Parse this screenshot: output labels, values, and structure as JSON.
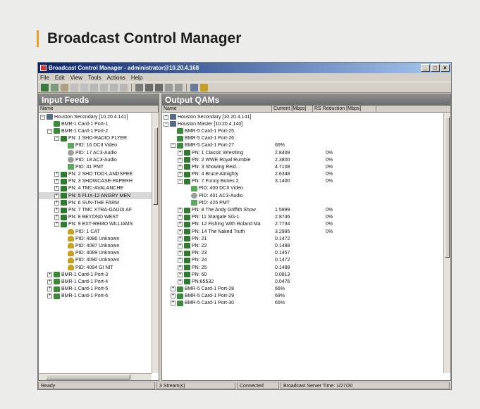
{
  "heading": "Broadcast Control Manager",
  "window": {
    "title": "Broadcast Control Manager - administrator@10.20.4.168",
    "minimize": "_",
    "restore": "□",
    "close": "×"
  },
  "menu": [
    "File",
    "Edit",
    "View",
    "Tools",
    "Actions",
    "Help"
  ],
  "input_feeds": {
    "title": "Input Feeds",
    "col_name": "Name",
    "rows": [
      {
        "exp": "−",
        "icon": "host",
        "text": "Houston Secondary [10.20.4.141]"
      },
      {
        "exp": "",
        "icon": "card",
        "text": "BMR-1 Card-1 Port-1"
      },
      {
        "exp": "−",
        "icon": "card",
        "text": "BMR-1 Card-1 Port-2"
      },
      {
        "exp": "−",
        "icon": "pn",
        "text": "PN:   1 SHO-RADIO FLYER"
      },
      {
        "exp": "",
        "icon": "pid",
        "text": "PID:   16 DCII Video"
      },
      {
        "exp": "",
        "icon": "audio",
        "text": "PID:   17 AC3-Audio"
      },
      {
        "exp": "",
        "icon": "audio",
        "text": "PID:   18 AC3-Audio"
      },
      {
        "exp": "",
        "icon": "pid",
        "text": "PID:   41 PMT"
      },
      {
        "exp": "+",
        "icon": "pn",
        "text": "PN:   2 SHO TOO-LANDSPEE"
      },
      {
        "exp": "+",
        "icon": "pn",
        "text": "PN:   3 SHOWCASE-PAPERH"
      },
      {
        "exp": "+",
        "icon": "pn",
        "text": "PN:   4 TMC-AVALANCHE"
      },
      {
        "exp": "+",
        "icon": "pn",
        "text": "PN:   5 FLIX-12 ANGRY MEN"
      },
      {
        "exp": "+",
        "icon": "pn",
        "text": "PN:   6 SUN-THE FARM"
      },
      {
        "exp": "+",
        "icon": "pn",
        "text": "PN:   7 TMC XTRA-GAUDI AF"
      },
      {
        "exp": "+",
        "icon": "pn",
        "text": "PN:   8 BEYOND WEST"
      },
      {
        "exp": "+",
        "icon": "pn",
        "text": "PN:   9 EXT-REMO WILLIAMS"
      },
      {
        "exp": "",
        "icon": "unk",
        "text": "PID:   1 CAT"
      },
      {
        "exp": "",
        "icon": "unk",
        "text": "PID: 4086 Unknown"
      },
      {
        "exp": "",
        "icon": "unk",
        "text": "PID: 4087 Unknown"
      },
      {
        "exp": "",
        "icon": "unk",
        "text": "PID: 4089 Unknown"
      },
      {
        "exp": "",
        "icon": "unk",
        "text": "PID: 4090 Unknown"
      },
      {
        "exp": "",
        "icon": "unk",
        "text": "PID: 4094 GI NIT"
      },
      {
        "exp": "+",
        "icon": "card",
        "text": "BMR-1 Card-1 Port-3"
      },
      {
        "exp": "+",
        "icon": "card",
        "text": "BMR-1 Card-1 Port-4"
      },
      {
        "exp": "+",
        "icon": "card",
        "text": "BMR-1 Card-1 Port-5"
      },
      {
        "exp": "+",
        "icon": "card",
        "text": "BMR-1 Card-1 Port-6"
      }
    ]
  },
  "output_qams": {
    "title": "Output QAMs",
    "col_name": "Name",
    "col_rate": "Current [Mbps]",
    "col_rs": "RS Reduction [Mbps]",
    "rows": [
      {
        "exp": "+",
        "icon": "host",
        "text": "Houston Secondary [10.20.4.141]",
        "rate": "",
        "rs": ""
      },
      {
        "exp": "−",
        "icon": "host",
        "text": "Houston Master [10.20.4.140]",
        "rate": "",
        "rs": ""
      },
      {
        "exp": "",
        "icon": "card",
        "text": "BMR-5 Card-1 Port-25",
        "rate": "",
        "rs": ""
      },
      {
        "exp": "",
        "icon": "card",
        "text": "BMR-5 Card-1 Port-26",
        "rate": "",
        "rs": ""
      },
      {
        "exp": "−",
        "icon": "card",
        "text": "BMR-5 Card-1 Port-27",
        "rate": "66%",
        "rs": ""
      },
      {
        "exp": "+",
        "icon": "pn",
        "text": "PN:   1 Classic Wrestling",
        "rate": "2.8409",
        "rs": "0%"
      },
      {
        "exp": "+",
        "icon": "pn",
        "text": "PN:   2 WWE Royal Rumble",
        "rate": "2.3800",
        "rs": "0%"
      },
      {
        "exp": "+",
        "icon": "pn",
        "text": "PN:   3 Showing Reid...",
        "rate": "4.7108",
        "rs": "0%"
      },
      {
        "exp": "+",
        "icon": "pn",
        "text": "PN:   4 Bruce Almighty",
        "rate": "2.6348",
        "rs": "0%"
      },
      {
        "exp": "−",
        "icon": "pn",
        "text": "PN:   7 Funny Bones 2",
        "rate": "3.1400",
        "rs": "0%"
      },
      {
        "exp": "",
        "icon": "pid",
        "text": "PID:  400 DCII Video",
        "rate": "",
        "rs": ""
      },
      {
        "exp": "",
        "icon": "audio",
        "text": "PID:  401 AC3-Audio",
        "rate": "",
        "rs": ""
      },
      {
        "exp": "",
        "icon": "pid",
        "text": "PID:  425 PMT",
        "rate": "",
        "rs": ""
      },
      {
        "exp": "+",
        "icon": "pn",
        "text": "PN:   8 The Andy Griffith Show",
        "rate": "1.5999",
        "rs": "0%"
      },
      {
        "exp": "+",
        "icon": "pn",
        "text": "PN:  11 Stargate SG-1",
        "rate": "2.8746",
        "rs": "0%"
      },
      {
        "exp": "+",
        "icon": "pn",
        "text": "PN:  12 Fishing With Roland Ma",
        "rate": "2.7734",
        "rs": "0%"
      },
      {
        "exp": "+",
        "icon": "pn",
        "text": "PN:  14 The Naked Truth",
        "rate": "3.2995",
        "rs": "0%"
      },
      {
        "exp": "+",
        "icon": "pn",
        "text": "PN:  21",
        "rate": "0.1472",
        "rs": ""
      },
      {
        "exp": "+",
        "icon": "pn",
        "text": "PN:  22",
        "rate": "0.1488",
        "rs": ""
      },
      {
        "exp": "+",
        "icon": "pn",
        "text": "PN:  23",
        "rate": "0.1457",
        "rs": ""
      },
      {
        "exp": "+",
        "icon": "pn",
        "text": "PN:  24",
        "rate": "0.1472",
        "rs": ""
      },
      {
        "exp": "+",
        "icon": "pn",
        "text": "PN:  25",
        "rate": "0.1488",
        "rs": ""
      },
      {
        "exp": "+",
        "icon": "pn",
        "text": "PN:  60",
        "rate": "0.0813",
        "rs": ""
      },
      {
        "exp": "+",
        "icon": "pn",
        "text": "PN:65532",
        "rate": "0.0476",
        "rs": ""
      },
      {
        "exp": "+",
        "icon": "card",
        "text": "BMR-5 Card-1 Port-28",
        "rate": "66%",
        "rs": ""
      },
      {
        "exp": "+",
        "icon": "card",
        "text": "BMR-5 Card-1 Port-29",
        "rate": "69%",
        "rs": ""
      },
      {
        "exp": "+",
        "icon": "card",
        "text": "BMR-5 Card-1 Port-30",
        "rate": "65%",
        "rs": ""
      }
    ]
  },
  "status": {
    "ready": "Ready",
    "streams": "3 Stream(s)",
    "connected": "Connected",
    "server_time": "Broadcast Server Time: 1/27/20"
  },
  "colors": {
    "accent": "#e8a020",
    "title_start": "#0a246a",
    "title_end": "#a6caf0"
  }
}
